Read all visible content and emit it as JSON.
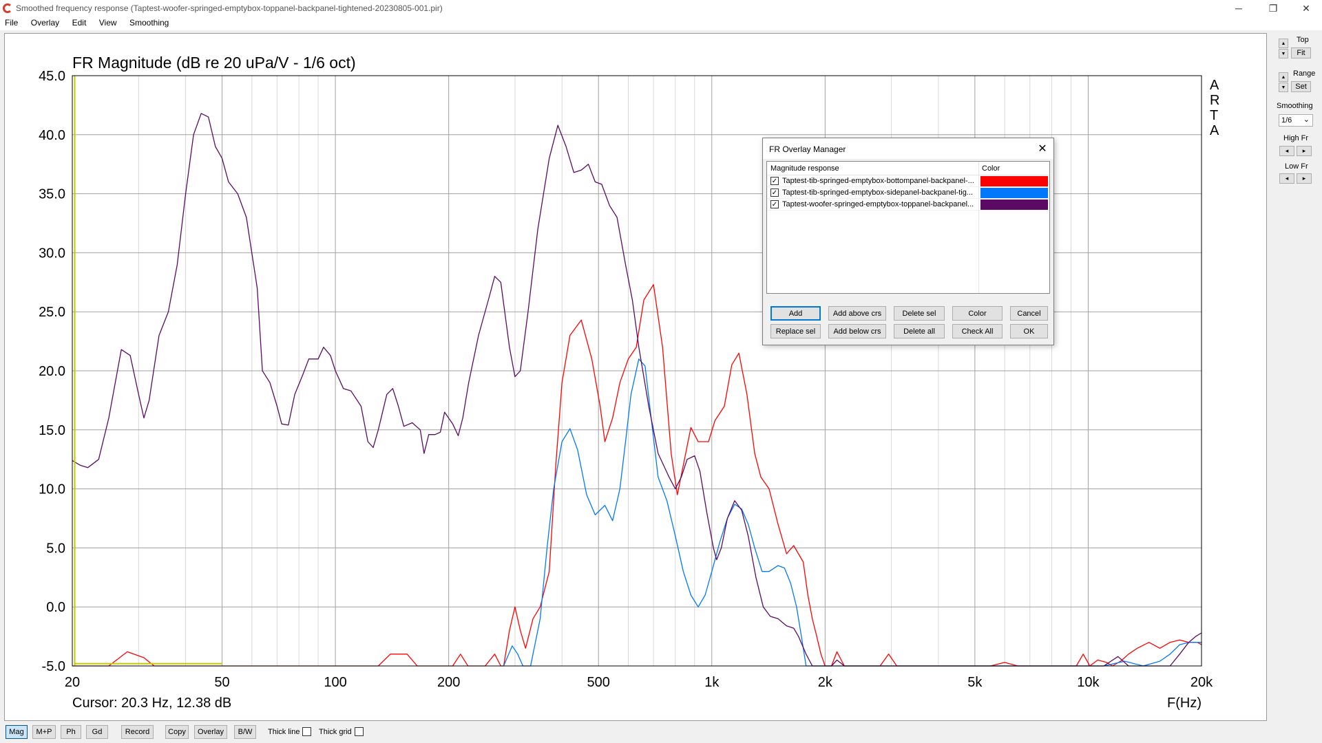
{
  "window": {
    "title": "Smoothed frequency response (Taptest-woofer-springed-emptybox-toppanel-backpanel-tightened-20230805-001.pir)",
    "minimize": "─",
    "restore": "❐",
    "close": "✕"
  },
  "menu": [
    "File",
    "Overlay",
    "Edit",
    "View",
    "Smoothing"
  ],
  "colors": {
    "series1": "#ff0000",
    "series2": "#0078ff",
    "series3": "#5a0a64",
    "marker": "#c8c800",
    "grid_major": "#a0a0a0",
    "grid_minor": "#d8d8d8"
  },
  "chart_data": {
    "type": "line",
    "title": "FR Magnitude (dB re 20 uPa/V - 1/6 oct)",
    "xlabel": "F(Hz)",
    "x_scale": "log",
    "xlim": [
      20,
      20000
    ],
    "ylim": [
      -5,
      45
    ],
    "y_ticks": [
      "45.0",
      "40.0",
      "35.0",
      "30.0",
      "25.0",
      "20.0",
      "15.0",
      "10.0",
      "5.0",
      "0.0",
      "-5.0"
    ],
    "x_ticks": [
      {
        "v": 20,
        "label": "20"
      },
      {
        "v": 50,
        "label": "50"
      },
      {
        "v": 100,
        "label": "100"
      },
      {
        "v": 200,
        "label": "200"
      },
      {
        "v": 500,
        "label": "500"
      },
      {
        "v": 1000,
        "label": "1k"
      },
      {
        "v": 2000,
        "label": "2k"
      },
      {
        "v": 5000,
        "label": "5k"
      },
      {
        "v": 10000,
        "label": "10k"
      },
      {
        "v": 20000,
        "label": "20k"
      }
    ],
    "cursor_text": "Cursor: 20.3 Hz, 12.38 dB",
    "brand_letters": [
      "A",
      "R",
      "T",
      "A"
    ],
    "cursor_marker": {
      "x": 20.3,
      "x_end": 50,
      "y": -4.8
    },
    "series": [
      {
        "name": "Taptest-tib-springed-emptybox-bottompanel-backpanel-...",
        "color": "#ff0000",
        "points": [
          [
            20,
            -5
          ],
          [
            25,
            -5
          ],
          [
            28,
            -3.8
          ],
          [
            31,
            -4.3
          ],
          [
            33,
            -5
          ],
          [
            130,
            -5
          ],
          [
            140,
            -4
          ],
          [
            155,
            -4
          ],
          [
            165,
            -5
          ],
          [
            205,
            -5
          ],
          [
            215,
            -4
          ],
          [
            225,
            -5
          ],
          [
            250,
            -5
          ],
          [
            265,
            -4
          ],
          [
            275,
            -5
          ],
          [
            280,
            -5
          ],
          [
            290,
            -2
          ],
          [
            300,
            0
          ],
          [
            310,
            -2
          ],
          [
            320,
            -3.5
          ],
          [
            335,
            -1
          ],
          [
            350,
            0
          ],
          [
            370,
            3
          ],
          [
            385,
            12
          ],
          [
            400,
            19
          ],
          [
            420,
            23
          ],
          [
            450,
            24.3
          ],
          [
            480,
            21
          ],
          [
            505,
            17
          ],
          [
            520,
            14
          ],
          [
            545,
            16
          ],
          [
            570,
            19
          ],
          [
            600,
            21
          ],
          [
            630,
            22
          ],
          [
            660,
            26
          ],
          [
            700,
            27.3
          ],
          [
            740,
            22
          ],
          [
            780,
            13
          ],
          [
            810,
            9.5
          ],
          [
            840,
            12
          ],
          [
            880,
            15.2
          ],
          [
            920,
            14
          ],
          [
            980,
            14
          ],
          [
            1020,
            15.8
          ],
          [
            1080,
            17
          ],
          [
            1130,
            20.5
          ],
          [
            1180,
            21.5
          ],
          [
            1240,
            18
          ],
          [
            1300,
            13
          ],
          [
            1350,
            11
          ],
          [
            1420,
            10
          ],
          [
            1500,
            7
          ],
          [
            1580,
            4.5
          ],
          [
            1650,
            5.2
          ],
          [
            1750,
            3.8
          ],
          [
            1800,
            1
          ],
          [
            1850,
            -1
          ],
          [
            1900,
            -2.5
          ],
          [
            1950,
            -4
          ],
          [
            2000,
            -5
          ],
          [
            2080,
            -5
          ],
          [
            2150,
            -3.8
          ],
          [
            2250,
            -5
          ],
          [
            2800,
            -5
          ],
          [
            2950,
            -4
          ],
          [
            3100,
            -5
          ],
          [
            5500,
            -5
          ],
          [
            6000,
            -4.7
          ],
          [
            6500,
            -5
          ],
          [
            9300,
            -5
          ],
          [
            9700,
            -4
          ],
          [
            10100,
            -5
          ],
          [
            10600,
            -4.5
          ],
          [
            11200,
            -4.7
          ],
          [
            11600,
            -5
          ],
          [
            12200,
            -4.6
          ],
          [
            12800,
            -4
          ],
          [
            13500,
            -3.5
          ],
          [
            14500,
            -3
          ],
          [
            15500,
            -3.5
          ],
          [
            16500,
            -3
          ],
          [
            17500,
            -2.8
          ],
          [
            18500,
            -3
          ],
          [
            19500,
            -3
          ],
          [
            20000,
            -3.2
          ]
        ]
      },
      {
        "name": "Taptest-tib-springed-emptybox-sidepanel-backpanel-tig...",
        "color": "#0078ff",
        "points": [
          [
            280,
            -5
          ],
          [
            295,
            -3.3
          ],
          [
            305,
            -4
          ],
          [
            315,
            -5
          ],
          [
            330,
            -5
          ],
          [
            350,
            -1
          ],
          [
            365,
            5
          ],
          [
            380,
            10
          ],
          [
            400,
            14
          ],
          [
            420,
            15.1
          ],
          [
            440,
            13.3
          ],
          [
            465,
            9.5
          ],
          [
            490,
            7.8
          ],
          [
            520,
            8.6
          ],
          [
            545,
            7.3
          ],
          [
            570,
            10
          ],
          [
            590,
            14
          ],
          [
            610,
            18
          ],
          [
            640,
            21
          ],
          [
            665,
            20.4
          ],
          [
            690,
            16
          ],
          [
            720,
            11
          ],
          [
            760,
            9
          ],
          [
            800,
            6
          ],
          [
            840,
            3
          ],
          [
            880,
            1
          ],
          [
            920,
            0
          ],
          [
            960,
            1
          ],
          [
            1000,
            3
          ],
          [
            1050,
            5.5
          ],
          [
            1100,
            7.5
          ],
          [
            1150,
            8.7
          ],
          [
            1200,
            8.3
          ],
          [
            1250,
            7
          ],
          [
            1300,
            5
          ],
          [
            1360,
            3
          ],
          [
            1420,
            3
          ],
          [
            1500,
            3.5
          ],
          [
            1560,
            3.3
          ],
          [
            1620,
            2
          ],
          [
            1680,
            0
          ],
          [
            1740,
            -3
          ],
          [
            1780,
            -5
          ],
          [
            5000,
            -5
          ],
          [
            11000,
            -5
          ],
          [
            12500,
            -4.6
          ],
          [
            14000,
            -5
          ],
          [
            15500,
            -4.6
          ],
          [
            16500,
            -4
          ],
          [
            17500,
            -3.2
          ],
          [
            18500,
            -3
          ],
          [
            20000,
            -3
          ]
        ]
      },
      {
        "name": "Taptest-woofer-springed-emptybox-toppanel-backpanel...",
        "color": "#5a0a64",
        "points": [
          [
            20,
            12.4
          ],
          [
            21,
            12
          ],
          [
            22,
            11.8
          ],
          [
            23.5,
            12.5
          ],
          [
            25,
            16
          ],
          [
            27,
            21.8
          ],
          [
            28.5,
            21.3
          ],
          [
            30,
            18
          ],
          [
            31,
            16
          ],
          [
            32,
            17.5
          ],
          [
            34,
            23
          ],
          [
            36,
            25
          ],
          [
            38,
            29
          ],
          [
            40,
            35
          ],
          [
            42,
            40
          ],
          [
            44,
            41.8
          ],
          [
            46,
            41.5
          ],
          [
            48,
            39
          ],
          [
            50,
            38
          ],
          [
            52,
            36
          ],
          [
            55,
            35
          ],
          [
            58,
            33
          ],
          [
            62,
            27
          ],
          [
            64,
            20
          ],
          [
            67,
            19
          ],
          [
            70,
            17
          ],
          [
            72,
            15.5
          ],
          [
            75,
            15.4
          ],
          [
            78,
            18
          ],
          [
            82,
            19.7
          ],
          [
            85,
            21
          ],
          [
            90,
            21
          ],
          [
            93,
            22
          ],
          [
            97,
            21.3
          ],
          [
            100,
            20
          ],
          [
            105,
            18.5
          ],
          [
            110,
            18.3
          ],
          [
            117,
            17
          ],
          [
            122,
            14
          ],
          [
            126,
            13.5
          ],
          [
            130,
            15
          ],
          [
            137,
            18
          ],
          [
            142,
            18.5
          ],
          [
            147,
            17
          ],
          [
            152,
            15.3
          ],
          [
            160,
            15.6
          ],
          [
            168,
            15
          ],
          [
            172,
            13
          ],
          [
            177,
            14.6
          ],
          [
            184,
            14.6
          ],
          [
            190,
            14.8
          ],
          [
            195,
            16.5
          ],
          [
            205,
            15.5
          ],
          [
            212,
            14.5
          ],
          [
            218,
            16
          ],
          [
            226,
            19
          ],
          [
            240,
            23
          ],
          [
            255,
            26
          ],
          [
            265,
            28
          ],
          [
            275,
            27.5
          ],
          [
            290,
            22
          ],
          [
            300,
            19.5
          ],
          [
            310,
            20
          ],
          [
            325,
            25
          ],
          [
            345,
            32
          ],
          [
            370,
            38
          ],
          [
            390,
            40.8
          ],
          [
            410,
            39
          ],
          [
            430,
            36.8
          ],
          [
            450,
            37
          ],
          [
            470,
            37.5
          ],
          [
            490,
            36
          ],
          [
            510,
            35.8
          ],
          [
            535,
            34
          ],
          [
            560,
            33
          ],
          [
            590,
            29
          ],
          [
            615,
            26
          ],
          [
            640,
            22
          ],
          [
            680,
            17
          ],
          [
            720,
            13
          ],
          [
            770,
            11
          ],
          [
            800,
            10
          ],
          [
            830,
            11
          ],
          [
            860,
            12.5
          ],
          [
            900,
            12.8
          ],
          [
            930,
            11.5
          ],
          [
            970,
            8
          ],
          [
            1010,
            5
          ],
          [
            1030,
            4
          ],
          [
            1060,
            5
          ],
          [
            1100,
            7.5
          ],
          [
            1150,
            9
          ],
          [
            1200,
            8.2
          ],
          [
            1250,
            6
          ],
          [
            1310,
            2.5
          ],
          [
            1370,
            0
          ],
          [
            1430,
            -0.8
          ],
          [
            1500,
            -1
          ],
          [
            1580,
            -1.6
          ],
          [
            1650,
            -1.8
          ],
          [
            1700,
            -2.5
          ],
          [
            1780,
            -4
          ],
          [
            1850,
            -5
          ],
          [
            2080,
            -5
          ],
          [
            2150,
            -4.5
          ],
          [
            2250,
            -5
          ],
          [
            5000,
            -5
          ],
          [
            11000,
            -5
          ],
          [
            12000,
            -4.2
          ],
          [
            12800,
            -5
          ],
          [
            16500,
            -5
          ],
          [
            17500,
            -4
          ],
          [
            18500,
            -3
          ],
          [
            19300,
            -2.5
          ],
          [
            20000,
            -2.2
          ]
        ]
      }
    ]
  },
  "dialog": {
    "title": "FR Overlay Manager",
    "close": "✕",
    "col_name": "Magnitude response",
    "col_color": "Color",
    "check": "✓",
    "buttons_row1": [
      "Add",
      "Add above crs",
      "Delete sel",
      "Color",
      "Cancel"
    ],
    "buttons_row2": [
      "Replace sel",
      "Add below crs",
      "Delete all",
      "Check All",
      "OK"
    ]
  },
  "rightpanel": {
    "top_label": "Top",
    "fit": "Fit",
    "range_label": "Range",
    "set": "Set",
    "smoothing_label": "Smoothing",
    "smoothing_value": "1/6",
    "high_fr_label": "High Fr",
    "low_fr_label": "Low Fr",
    "up": "▲",
    "down": "▼",
    "left": "◂",
    "right": "▸",
    "dropdown": "⌄"
  },
  "bottombar": {
    "buttons": [
      "Mag",
      "M+P",
      "Ph",
      "Gd",
      "Record",
      "Copy",
      "Overlay",
      "B/W"
    ],
    "thick_line": "Thick line",
    "thick_grid": "Thick grid"
  }
}
